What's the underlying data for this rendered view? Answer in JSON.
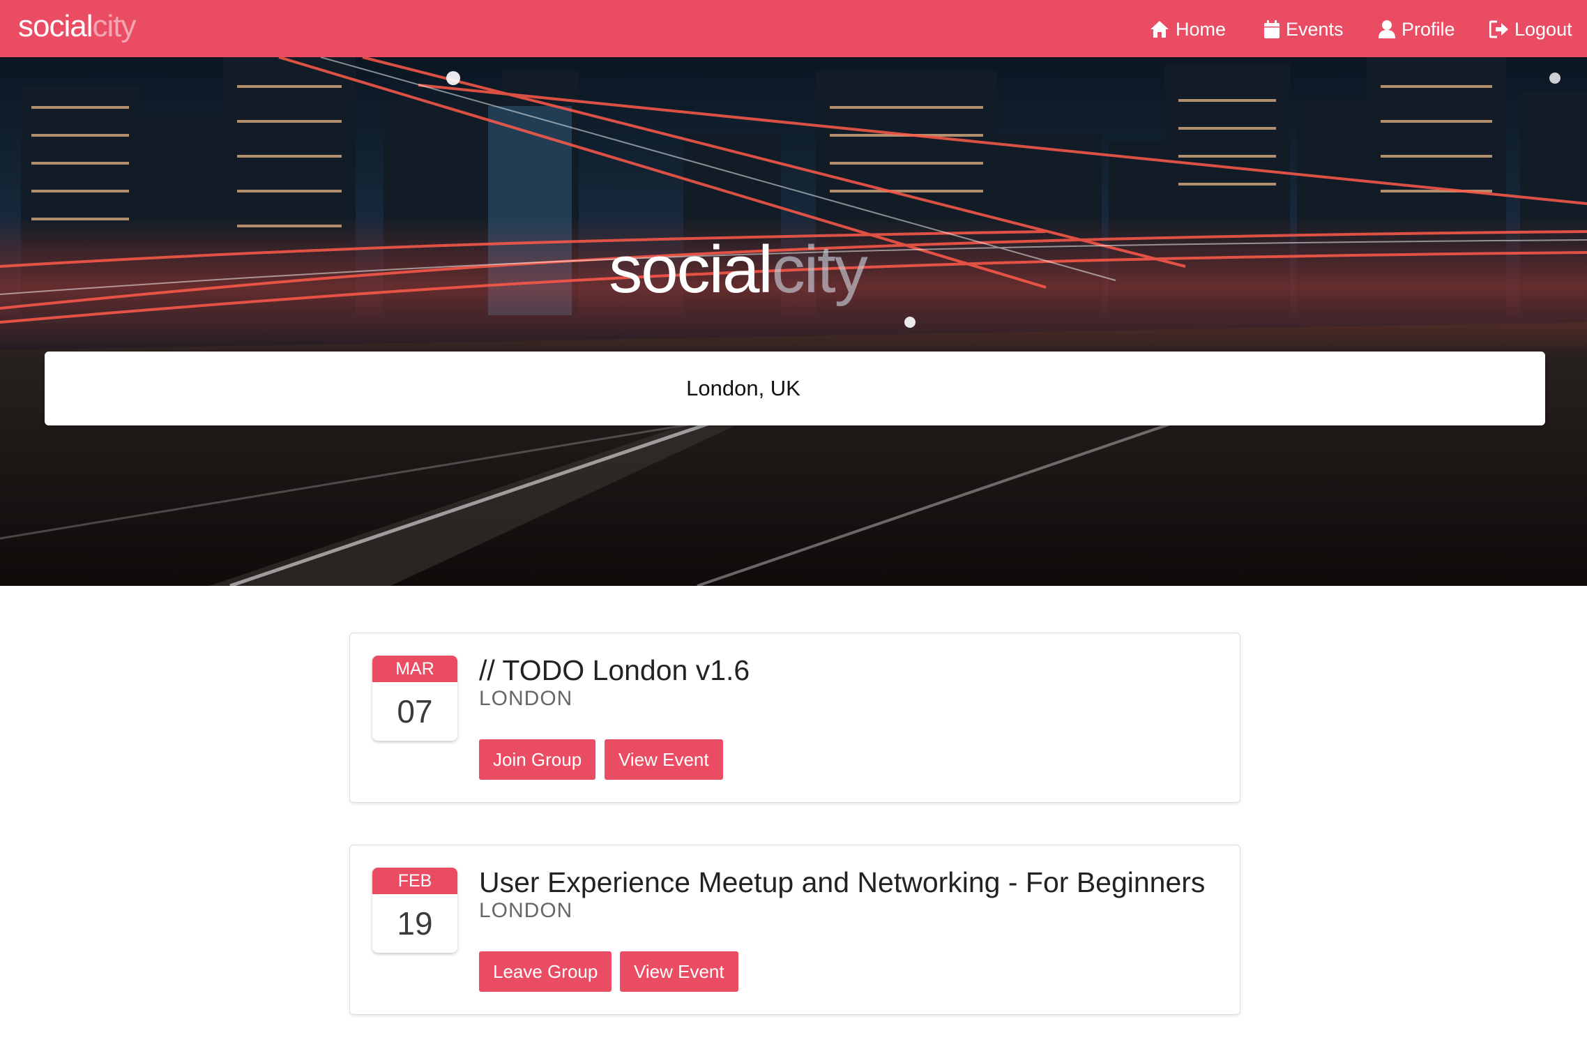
{
  "colors": {
    "accent": "#ea4d63",
    "brand_secondary": "#f4a7b2",
    "text_dark": "#222222",
    "text_muted": "#666666"
  },
  "navbar": {
    "brand_part1": "social",
    "brand_part2": "city",
    "items": [
      {
        "label": "Home",
        "icon": "home-icon"
      },
      {
        "label": "Events",
        "icon": "calendar-icon"
      },
      {
        "label": "Profile",
        "icon": "user-icon"
      },
      {
        "label": "Logout",
        "icon": "sign-out-icon"
      }
    ]
  },
  "hero": {
    "title_part1": "social",
    "title_part2": "city",
    "location": "London, UK"
  },
  "events": [
    {
      "month": "MAR",
      "day": "07",
      "title": "// TODO London v1.6",
      "city": "LONDON",
      "primary_action": "Join Group",
      "secondary_action": "View Event"
    },
    {
      "month": "FEB",
      "day": "19",
      "title": "User Experience Meetup and Networking - For Beginners",
      "city": "LONDON",
      "primary_action": "Leave Group",
      "secondary_action": "View Event"
    }
  ]
}
